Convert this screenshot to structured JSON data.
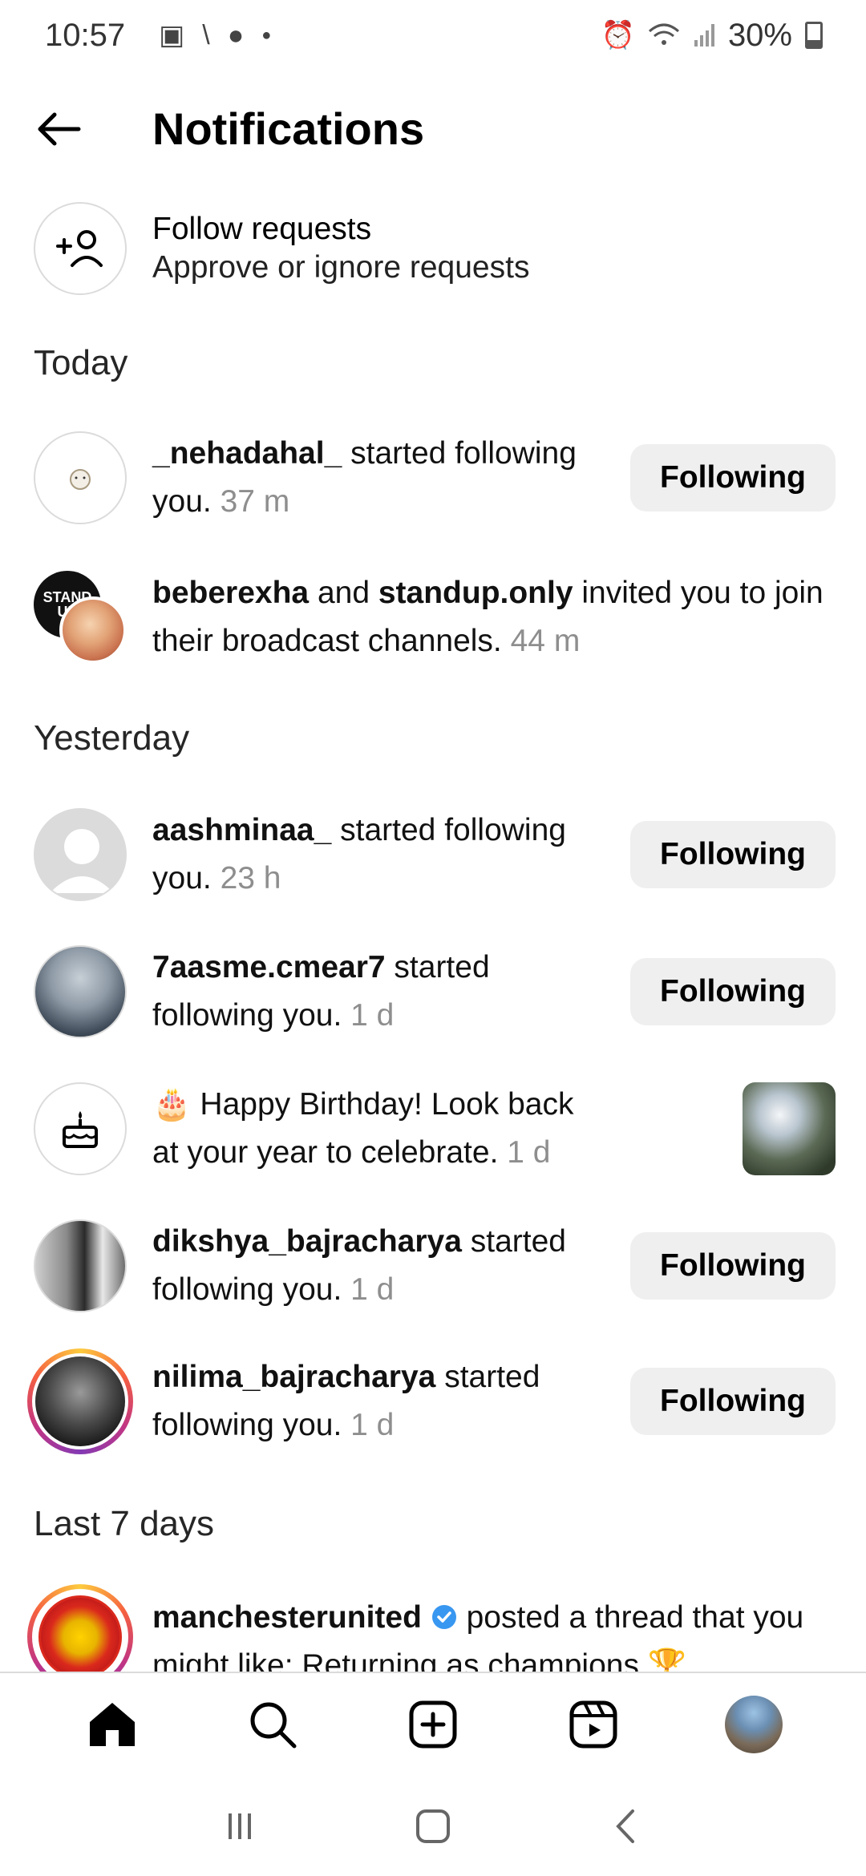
{
  "status_bar": {
    "time": "10:57",
    "battery": "30%"
  },
  "header": {
    "title": "Notifications"
  },
  "follow_requests": {
    "title": "Follow requests",
    "subtitle": "Approve or ignore requests"
  },
  "sections": {
    "today": "Today",
    "yesterday": "Yesterday",
    "last7": "Last 7 days"
  },
  "notifications": {
    "n1": {
      "user": "_nehadahal_",
      "text": " started following you. ",
      "time": "37 m",
      "button": "Following"
    },
    "n2": {
      "user1": "beberexha",
      "and": " and ",
      "user2": "standup.only",
      "text": " invited you to join their broadcast channels. ",
      "time": "44 m",
      "avatar_text": "STAND UP"
    },
    "n3": {
      "user": "aashminaa_",
      "text": " started following you. ",
      "time": "23 h",
      "button": "Following"
    },
    "n4": {
      "user": "7aasme.cmear7",
      "text": " started following you. ",
      "time": "1 d",
      "button": "Following"
    },
    "n5": {
      "emoji": "🎂",
      "text": " Happy Birthday! Look back at your year to celebrate. ",
      "time": "1 d"
    },
    "n6": {
      "user": "dikshya_bajracharya",
      "text": " started following you. ",
      "time": "1 d",
      "button": "Following"
    },
    "n7": {
      "user": "nilima_bajracharya",
      "text": " started following you. ",
      "time": "1 d",
      "button": "Following"
    },
    "n8": {
      "user": "manchesterunited",
      "text": " posted a thread that you might like: Returning as champions 🏆"
    }
  },
  "colors": {
    "verified": "#3897f0",
    "time_gray": "#8e8e8e",
    "button_bg": "#efefef"
  },
  "icons": [
    "back-arrow-icon",
    "add-person-icon",
    "birthday-cake-icon",
    "home-icon",
    "search-icon",
    "create-icon",
    "reels-icon",
    "verified-badge-icon"
  ]
}
